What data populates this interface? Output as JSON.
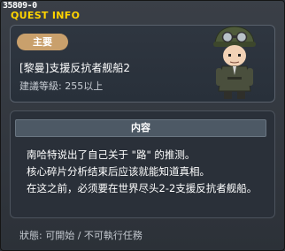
{
  "window": {
    "quest_id": "35809-0",
    "title": "QUEST INFO"
  },
  "quest": {
    "badge": "主要",
    "name": "[黎曼]支援反抗者舰船2",
    "level": "建議等級: 255以上"
  },
  "content": {
    "header": "内容",
    "lines": [
      "南哈特说出了自己关于 \"路\" 的推测。",
      "核心碎片分析结束后应该就能知道真相。",
      "在这之前，必须要在世界尽头2-2支援反抗者舰船。"
    ]
  },
  "status": "狀態: 可開始 / 不可執行任務",
  "colors": {
    "title": "#ffd400",
    "badge": "#c9a06c",
    "content_header": "#4d5965"
  },
  "icons": {
    "character": "npc-portrait-icon"
  }
}
